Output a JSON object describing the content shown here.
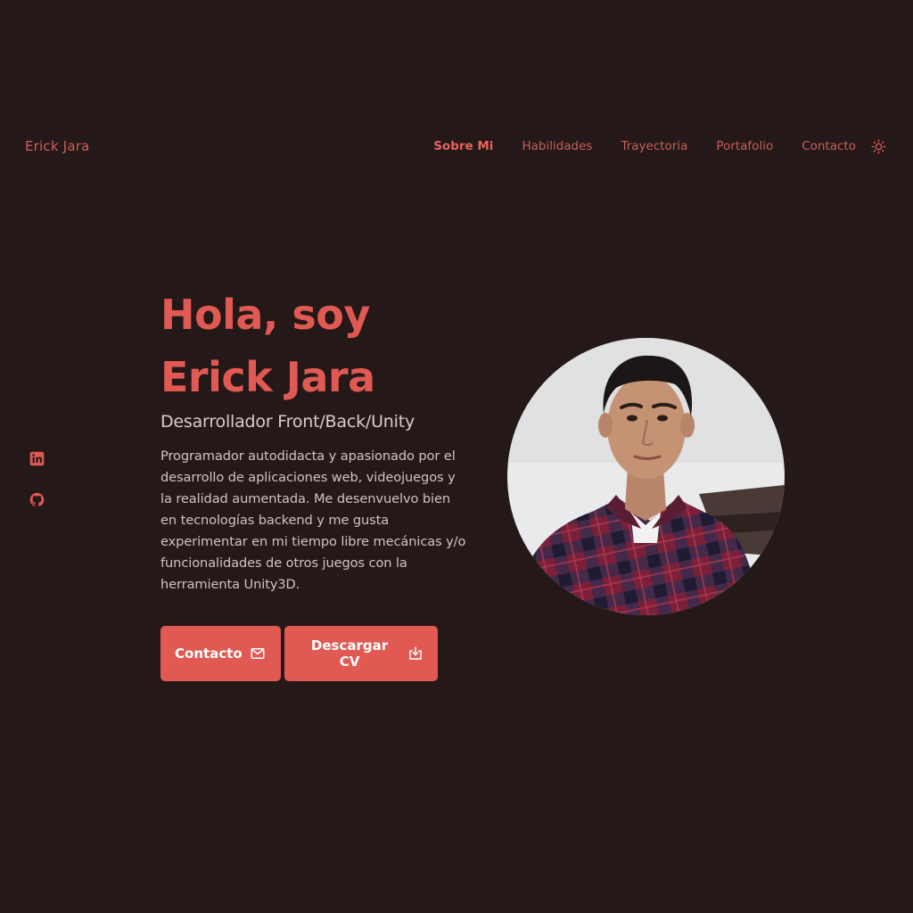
{
  "header": {
    "logo": "Erick Jara",
    "nav": [
      {
        "label": "Sobre Mi",
        "active": true
      },
      {
        "label": "Habilidades",
        "active": false
      },
      {
        "label": "Trayectoria",
        "active": false
      },
      {
        "label": "Portafolio",
        "active": false
      },
      {
        "label": "Contacto",
        "active": false
      }
    ],
    "theme_icon": "sun-icon"
  },
  "social": [
    {
      "icon": "linkedin-icon"
    },
    {
      "icon": "github-icon"
    }
  ],
  "hero": {
    "title_line1": "Hola, soy",
    "title_line2": "Erick Jara",
    "subtitle": "Desarrollador Front/Back/Unity",
    "description": "Programador autodidacta y apasionado por el desarrollo de aplicaciones web, videojuegos y la realidad aumentada. Me desenvuelvo bien en tecnologías backend y me gusta experimentar en mi tiempo libre mecánicas y/o funcionalidades de otros juegos con la herramienta Unity3D.",
    "buttons": {
      "contact_label": "Contacto",
      "contact_icon": "mail-icon",
      "cv_label": "Descargar CV",
      "cv_icon": "download-icon"
    }
  },
  "colors": {
    "background": "#241818",
    "accent": "#e05a53",
    "text": "#cfc3c3"
  }
}
